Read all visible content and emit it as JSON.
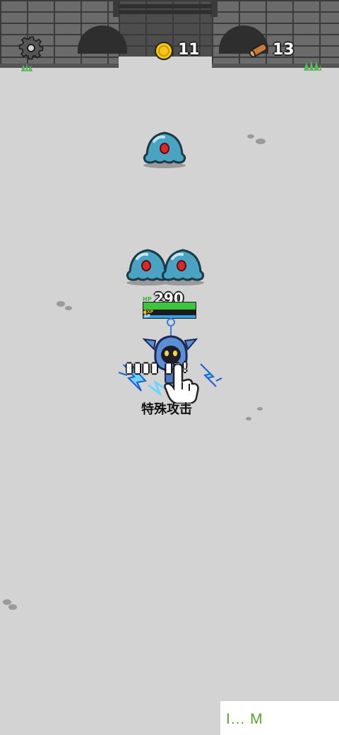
{
  "hud": {
    "settings_icon": "gear-icon",
    "coins": "11",
    "coin_icon": "coin-icon",
    "wood": "13",
    "wood_icon": "log-icon"
  },
  "player": {
    "hp_label": "HP",
    "hp_value": "290",
    "exp_label": "EXP",
    "sp_label": "SP",
    "hp_fraction": 1.0,
    "exp_fraction": 0.05,
    "sp_fraction": 1.0
  },
  "action": {
    "shout_text": "!",
    "skill_label": "特殊攻击"
  },
  "enemies": [
    {
      "name": "blue-slime",
      "color": "#4aa3c2"
    },
    {
      "name": "blue-slime",
      "color": "#4aa3c2"
    },
    {
      "name": "blue-slime",
      "color": "#4aa3c2"
    }
  ],
  "colors": {
    "ground": "#d3d3d3",
    "wall": "#6b6b6b",
    "hp_bar": "#3ec43e",
    "exp_bar": "#f2c21e",
    "sp_bar": "#2ea3e0",
    "watermark": "#5aa02c"
  },
  "watermark": "I... M"
}
